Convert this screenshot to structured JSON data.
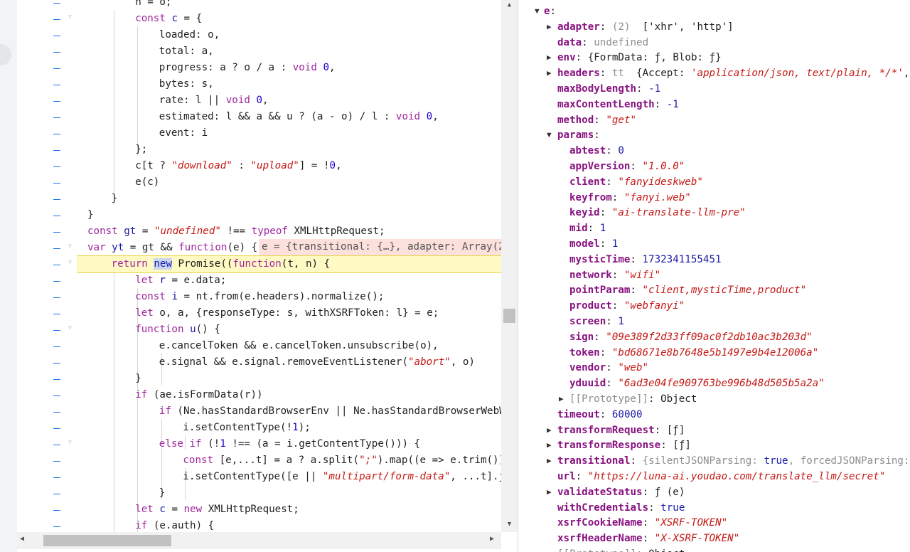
{
  "code_lines": [
    [
      {
        "t": "n = o;"
      }
    ],
    [
      {
        "t": "const ",
        "c": "kw"
      },
      {
        "t": "c",
        "c": "def"
      },
      {
        "t": " = {"
      }
    ],
    [
      {
        "t": "loaded: o,"
      }
    ],
    [
      {
        "t": "total: a,"
      }
    ],
    [
      {
        "t": "progress: a ? o / a : "
      },
      {
        "t": "void ",
        "c": "kw"
      },
      {
        "t": "0",
        "c": "num"
      },
      {
        "t": ","
      }
    ],
    [
      {
        "t": "bytes: s,"
      }
    ],
    [
      {
        "t": "rate: l || "
      },
      {
        "t": "void ",
        "c": "kw"
      },
      {
        "t": "0",
        "c": "num"
      },
      {
        "t": ","
      }
    ],
    [
      {
        "t": "estimated: l && a && u ? (a - o) / l : "
      },
      {
        "t": "void ",
        "c": "kw"
      },
      {
        "t": "0",
        "c": "num"
      },
      {
        "t": ","
      }
    ],
    [
      {
        "t": "event: i"
      }
    ],
    [
      {
        "t": "};"
      }
    ],
    [
      {
        "t": "c[t ? "
      },
      {
        "t": "\"download\"",
        "c": "str"
      },
      {
        "t": " : "
      },
      {
        "t": "\"upload\"",
        "c": "str"
      },
      {
        "t": "] = !"
      },
      {
        "t": "0",
        "c": "num"
      },
      {
        "t": ","
      }
    ],
    [
      {
        "t": "e(c)"
      }
    ],
    [
      {
        "t": "}"
      }
    ],
    [
      {
        "t": "}"
      }
    ],
    [
      {
        "t": "const ",
        "c": "kw"
      },
      {
        "t": "gt",
        "c": "def"
      },
      {
        "t": " = "
      },
      {
        "t": "\"undefined\"",
        "c": "str"
      },
      {
        "t": " !== "
      },
      {
        "t": "typeof ",
        "c": "kw"
      },
      {
        "t": "XMLHttpRequest;"
      }
    ],
    [
      {
        "t": "var ",
        "c": "kw"
      },
      {
        "t": "yt",
        "c": "def"
      },
      {
        "t": " = gt && "
      },
      {
        "t": "function",
        "c": "kw"
      },
      {
        "t": "(e) {"
      }
    ],
    [
      {
        "t": "return ",
        "c": "kw"
      },
      {
        "t": "new",
        "c": "kwb",
        "hl": true
      },
      {
        "t": " Promise(("
      },
      {
        "t": "function",
        "c": "kw"
      },
      {
        "t": "(t, n) {"
      }
    ],
    [
      {
        "t": "let ",
        "c": "kw"
      },
      {
        "t": "r",
        "c": "def"
      },
      {
        "t": " = e.data;"
      }
    ],
    [
      {
        "t": "const ",
        "c": "kw"
      },
      {
        "t": "i",
        "c": "def"
      },
      {
        "t": " = nt.from(e.headers).normalize();"
      }
    ],
    [
      {
        "t": "let ",
        "c": "kw"
      },
      {
        "t": "o, a, {responseType: s, withXSRFToken: l} = e;"
      }
    ],
    [
      {
        "t": "function ",
        "c": "kw"
      },
      {
        "t": "u",
        "c": "def"
      },
      {
        "t": "() {"
      }
    ],
    [
      {
        "t": "e.cancelToken && e.cancelToken.unsubscribe(o),"
      }
    ],
    [
      {
        "t": "e.signal && e.signal.removeEventListener("
      },
      {
        "t": "\"abort\"",
        "c": "str"
      },
      {
        "t": ", o)"
      }
    ],
    [
      {
        "t": "}"
      }
    ],
    [
      {
        "t": "if ",
        "c": "kw"
      },
      {
        "t": "(ae.isFormData(r))"
      }
    ],
    [
      {
        "t": "if ",
        "c": "kw"
      },
      {
        "t": "(Ne.hasStandardBrowserEnv || Ne.hasStandardBrowserWebWorker"
      }
    ],
    [
      {
        "t": "i.setContentType(!"
      },
      {
        "t": "1",
        "c": "num"
      },
      {
        "t": ");"
      }
    ],
    [
      {
        "t": "else if ",
        "c": "kw"
      },
      {
        "t": "(!"
      },
      {
        "t": "1",
        "c": "num"
      },
      {
        "t": " !== (a = i.getContentType())) {"
      }
    ],
    [
      {
        "t": "const ",
        "c": "kw"
      },
      {
        "t": "[e,...t] = a ? a.split("
      },
      {
        "t": "\";\"",
        "c": "str"
      },
      {
        "t": ").map((e => e.trim())).filter"
      }
    ],
    [
      {
        "t": "i.setContentType([e || "
      },
      {
        "t": "\"multipart/form-data\"",
        "c": "str"
      },
      {
        "t": ", ...t].join("
      }
    ],
    [
      {
        "t": "}"
      }
    ],
    [
      {
        "t": "let ",
        "c": "kw"
      },
      {
        "t": "c",
        "c": "def"
      },
      {
        "t": " = "
      },
      {
        "t": "new ",
        "c": "kw"
      },
      {
        "t": "XMLHttpRequest;"
      }
    ],
    [
      {
        "t": "if ",
        "c": "kw"
      },
      {
        "t": "(e.auth) {"
      }
    ]
  ],
  "inline_value": "e = {transitional: {…}, adapter: Array(2)",
  "scope": [
    {
      "key": "e",
      "suffix": ":",
      "tri": "open"
    },
    {
      "key": "adapter",
      "tri": "closed",
      "v": [
        {
          "t": "(2) ",
          "c": "s-dim"
        },
        {
          "t": " ['xhr', 'http']",
          "c": "s-plain"
        }
      ]
    },
    {
      "key": "data",
      "v": [
        {
          "t": "undefined",
          "c": "s-dim"
        }
      ]
    },
    {
      "key": "env",
      "tri": "closed",
      "v": [
        {
          "t": "{FormData: ",
          "c": "s-plain"
        },
        {
          "t": "ƒ",
          "c": "s-plain"
        },
        {
          "t": ", Blob: ",
          "c": "s-plain"
        },
        {
          "t": "ƒ",
          "c": "s-plain"
        },
        {
          "t": "}",
          "c": "s-plain"
        }
      ]
    },
    {
      "key": "headers",
      "tri": "closed",
      "v": [
        {
          "t": "tt ",
          "c": "s-dim"
        },
        {
          "t": " {Accept: ",
          "c": "s-plain"
        },
        {
          "t": "'application/json, text/plain, */*'",
          "c": "s-str"
        },
        {
          "t": ", Co",
          "c": "s-plain"
        }
      ]
    },
    {
      "key": "maxBodyLength",
      "v": [
        {
          "t": "-1",
          "c": "s-num"
        }
      ]
    },
    {
      "key": "maxContentLength",
      "v": [
        {
          "t": "-1",
          "c": "s-num"
        }
      ]
    },
    {
      "key": "method",
      "v": [
        {
          "t": "\"get\"",
          "c": "s-str"
        }
      ]
    },
    {
      "key": "params",
      "suffix": ":",
      "tri": "open"
    },
    {
      "key": "abtest",
      "v": [
        {
          "t": "0",
          "c": "s-num"
        }
      ]
    },
    {
      "key": "appVersion",
      "v": [
        {
          "t": "\"1.0.0\"",
          "c": "s-str"
        }
      ]
    },
    {
      "key": "client",
      "v": [
        {
          "t": "\"fanyideskweb\"",
          "c": "s-str"
        }
      ]
    },
    {
      "key": "keyfrom",
      "v": [
        {
          "t": "\"fanyi.web\"",
          "c": "s-str"
        }
      ]
    },
    {
      "key": "keyid",
      "v": [
        {
          "t": "\"ai-translate-llm-pre\"",
          "c": "s-str"
        }
      ]
    },
    {
      "key": "mid",
      "v": [
        {
          "t": "1",
          "c": "s-num"
        }
      ]
    },
    {
      "key": "model",
      "v": [
        {
          "t": "1",
          "c": "s-num"
        }
      ]
    },
    {
      "key": "mysticTime",
      "v": [
        {
          "t": "1732341155451",
          "c": "s-num"
        }
      ]
    },
    {
      "key": "network",
      "v": [
        {
          "t": "\"wifi\"",
          "c": "s-str"
        }
      ]
    },
    {
      "key": "pointParam",
      "v": [
        {
          "t": "\"client,mysticTime,product\"",
          "c": "s-str"
        }
      ]
    },
    {
      "key": "product",
      "v": [
        {
          "t": "\"webfanyi\"",
          "c": "s-str"
        }
      ]
    },
    {
      "key": "screen",
      "v": [
        {
          "t": "1",
          "c": "s-num"
        }
      ]
    },
    {
      "key": "sign",
      "v": [
        {
          "t": "\"09e389f2d33ff09ac0f2db10ac3b203d\"",
          "c": "s-str"
        }
      ]
    },
    {
      "key": "token",
      "v": [
        {
          "t": "\"bd68671e8b7648e5b1497e9b4e12006a\"",
          "c": "s-str"
        }
      ]
    },
    {
      "key": "vendor",
      "v": [
        {
          "t": "\"web\"",
          "c": "s-str"
        }
      ]
    },
    {
      "key": "yduuid",
      "v": [
        {
          "t": "\"6ad3e04fe909763be996b48d505b5a2a\"",
          "c": "s-str"
        }
      ]
    },
    {
      "key": "[[Prototype]]",
      "proto": true,
      "tri": "closed",
      "v": [
        {
          "t": "Object",
          "c": "s-plain"
        }
      ]
    },
    {
      "key": "timeout",
      "v": [
        {
          "t": "60000",
          "c": "s-num"
        }
      ]
    },
    {
      "key": "transformRequest",
      "tri": "closed",
      "v": [
        {
          "t": "[ƒ]",
          "c": "s-plain"
        }
      ]
    },
    {
      "key": "transformResponse",
      "tri": "closed",
      "v": [
        {
          "t": "[ƒ]",
          "c": "s-plain"
        }
      ]
    },
    {
      "key": "transitional",
      "tri": "closed",
      "v": [
        {
          "t": "{silentJSONParsing: ",
          "c": "s-dim"
        },
        {
          "t": "true",
          "c": "s-num"
        },
        {
          "t": ", forcedJSONParsing: ",
          "c": "s-dim"
        },
        {
          "t": "tr",
          "c": "s-num"
        }
      ]
    },
    {
      "key": "url",
      "v": [
        {
          "t": "\"https://luna-ai.youdao.com/translate_llm/secret\"",
          "c": "s-str"
        }
      ]
    },
    {
      "key": "validateStatus",
      "tri": "closed",
      "v": [
        {
          "t": "ƒ (e)",
          "c": "s-plain"
        }
      ]
    },
    {
      "key": "withCredentials",
      "v": [
        {
          "t": "true",
          "c": "s-num"
        }
      ]
    },
    {
      "key": "xsrfCookieName",
      "v": [
        {
          "t": "\"XSRF-TOKEN\"",
          "c": "s-str"
        }
      ]
    },
    {
      "key": "xsrfHeaderName",
      "v": [
        {
          "t": "\"X-XSRF-TOKEN\"",
          "c": "s-str"
        }
      ]
    },
    {
      "key": "[[Prototype]]",
      "proto": true,
      "tri": "closed",
      "v": [
        {
          "t": "Object",
          "c": "s-plain"
        }
      ]
    }
  ]
}
